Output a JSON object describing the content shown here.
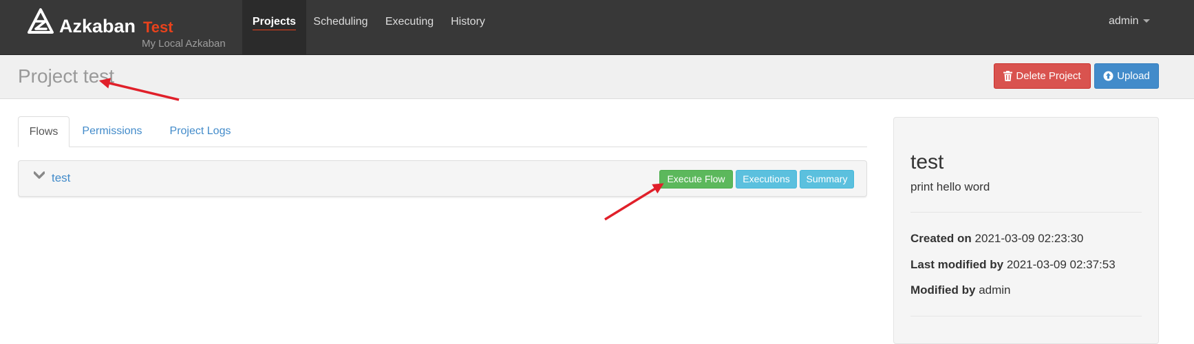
{
  "navbar": {
    "brand_name": "Azkaban",
    "brand_env": "Test",
    "brand_sub": "My Local Azkaban",
    "items": [
      {
        "label": "Projects",
        "active": true
      },
      {
        "label": "Scheduling"
      },
      {
        "label": "Executing"
      },
      {
        "label": "History"
      }
    ],
    "user": "admin"
  },
  "page_header": {
    "title": "Project test",
    "delete_label": "Delete Project",
    "upload_label": "Upload"
  },
  "tabs": [
    {
      "label": "Flows",
      "active": true
    },
    {
      "label": "Permissions"
    },
    {
      "label": "Project Logs"
    }
  ],
  "flows": [
    {
      "name": "test",
      "execute_label": "Execute Flow",
      "executions_label": "Executions",
      "summary_label": "Summary"
    }
  ],
  "project_info": {
    "name": "test",
    "description": "print hello word",
    "created_on_label": "Created on",
    "created_on": "2021-03-09 02:23:30",
    "last_modified_label": "Last modified by",
    "last_modified": "2021-03-09 02:37:53",
    "modified_by_label": "Modified by",
    "modified_by": "admin"
  },
  "colors": {
    "navbar_bg": "#383838",
    "accent": "#e8421c",
    "link": "#428bca",
    "danger": "#d9534f",
    "success": "#5cb85c",
    "info": "#5bc0de",
    "annotation_arrow": "#e0202a"
  }
}
